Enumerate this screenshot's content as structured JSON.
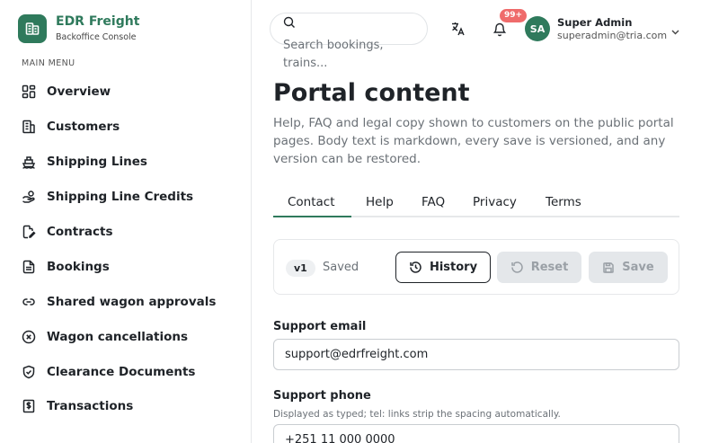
{
  "brand": {
    "name": "EDR Freight",
    "subtitle": "Backoffice Console"
  },
  "sidebar": {
    "heading": "MAIN MENU",
    "items": [
      {
        "label": "Overview",
        "icon": "grid-icon"
      },
      {
        "label": "Customers",
        "icon": "building-icon"
      },
      {
        "label": "Shipping Lines",
        "icon": "ship-icon"
      },
      {
        "label": "Shipping Line Credits",
        "icon": "hand-coins-icon"
      },
      {
        "label": "Contracts",
        "icon": "file-edit-icon"
      },
      {
        "label": "Bookings",
        "icon": "file-text-icon"
      },
      {
        "label": "Shared wagon approvals",
        "icon": "link-icon"
      },
      {
        "label": "Wagon cancellations",
        "icon": "x-circle-icon"
      },
      {
        "label": "Clearance Documents",
        "icon": "shield-check-icon"
      },
      {
        "label": "Transactions",
        "icon": "receipt-dollar-icon"
      }
    ]
  },
  "header": {
    "search_placeholder": "Search bookings, trains...",
    "notification_badge": "99+",
    "user": {
      "initials": "SA",
      "name": "Super Admin",
      "email": "superadmin@tria.com"
    }
  },
  "main": {
    "title": "Portal content",
    "description": "Help, FAQ and legal copy shown to customers on the public portal pages. Body text is markdown, every save is versioned, and any version can be restored.",
    "tabs": [
      {
        "label": "Contact",
        "active": true
      },
      {
        "label": "Help",
        "active": false
      },
      {
        "label": "FAQ",
        "active": false
      },
      {
        "label": "Privacy",
        "active": false
      },
      {
        "label": "Terms",
        "active": false
      }
    ],
    "version": {
      "label": "v1",
      "status": "Saved"
    },
    "buttons": {
      "history": "History",
      "reset": "Reset",
      "save": "Save"
    },
    "fields": {
      "support_email": {
        "label": "Support email",
        "value": "support@edrfreight.com"
      },
      "support_phone": {
        "label": "Support phone",
        "help": "Displayed as typed; tel: links strip the spacing automatically.",
        "value": "+251 11 000 0000"
      }
    }
  },
  "colors": {
    "brand": "#2f7a5c",
    "badge": "#ef6b6b",
    "disabled_bg": "#e4e7ea"
  }
}
